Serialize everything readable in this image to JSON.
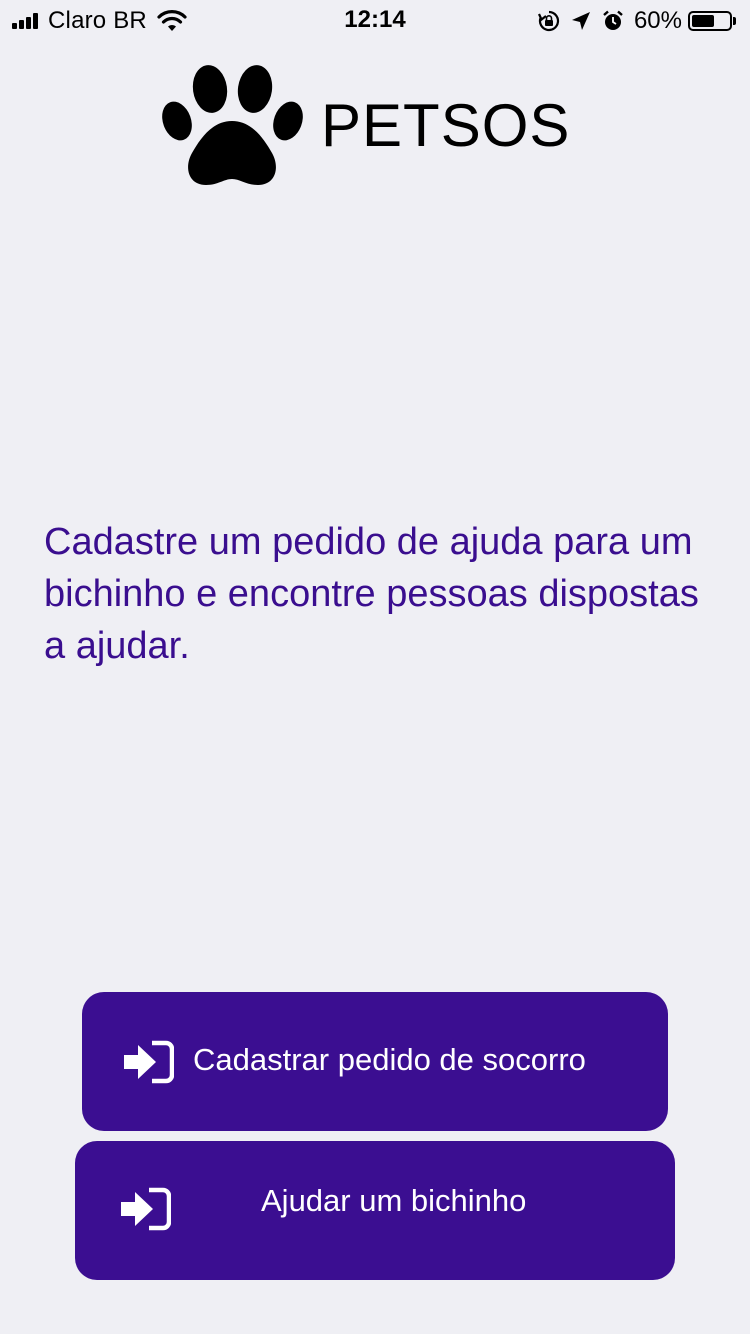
{
  "status_bar": {
    "carrier": "Claro BR",
    "time": "12:14",
    "battery_percent": "60%",
    "battery_level": 0.6,
    "icons": [
      "signal-icon",
      "wifi-icon",
      "rotation-lock-icon",
      "location-icon",
      "alarm-icon",
      "battery-icon"
    ]
  },
  "header": {
    "logo_icon": "paw-icon",
    "title": "PETSOS"
  },
  "main": {
    "description": "Cadastre um pedido de ajuda para um bichinho e encontre pessoas dispostas a ajudar."
  },
  "buttons": [
    {
      "label": "Cadastrar pedido de socorro",
      "icon": "sign-in-icon"
    },
    {
      "label": "Ajudar um bichinho",
      "icon": "sign-in-icon"
    }
  ],
  "colors": {
    "background": "#efeff4",
    "accent": "#3b0e91",
    "description_text": "#3a0e8f",
    "button_text": "#ffffff"
  }
}
